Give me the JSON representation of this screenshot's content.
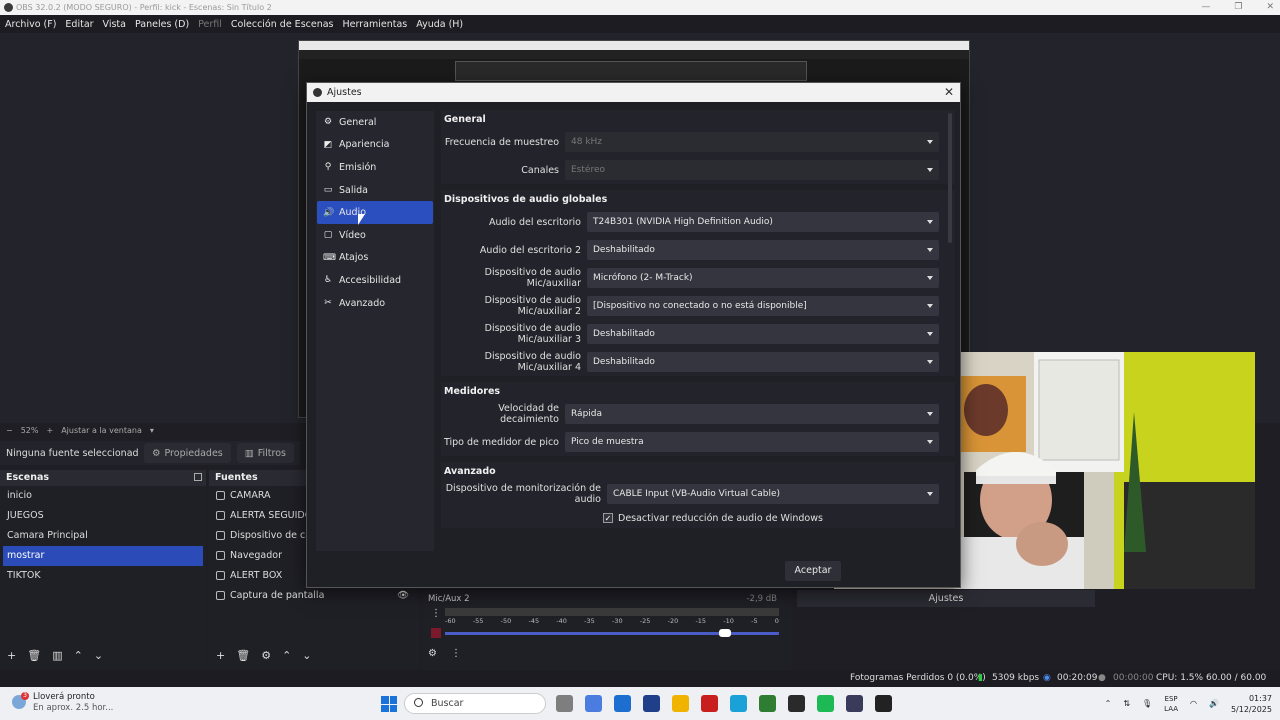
{
  "window": {
    "title": "OBS 32.0.2 (MODO SEGURO) - Perfil: kick - Escenas: Sin Título 2",
    "controls": [
      "—",
      "❐",
      "✕"
    ]
  },
  "menu": [
    "Archivo (F)",
    "Editar",
    "Vista",
    "Paneles (D)",
    "Perfil",
    "Colección de Escenas",
    "Herramientas",
    "Ayuda (H)"
  ],
  "preview": {
    "zoom": "52%",
    "fit_label": "Ajustar a la ventana"
  },
  "properties_strip": {
    "no_source": "Ninguna fuente seleccionad",
    "properties_btn": "Propiedades",
    "filters_btn": "Filtros"
  },
  "scenes": {
    "header": "Escenas",
    "items": [
      "inicio",
      "JUEGOS",
      "Camara Principal",
      "mostrar",
      "TIKTOK"
    ],
    "selected": "mostrar"
  },
  "sources": {
    "header": "Fuentes",
    "items": [
      "CAMARA",
      "ALERTA SEGUIDOR",
      "Dispositivo de capt",
      "Navegador",
      "ALERT BOX",
      "Captura de pantalla"
    ]
  },
  "mixer": {
    "label": "Mic/Aux 2",
    "db": "-2,9 dB",
    "ticks": [
      "-60",
      "-55",
      "-50",
      "-45",
      "-40",
      "-35",
      "-30",
      "-25",
      "-20",
      "-15",
      "-10",
      "-5",
      "0"
    ]
  },
  "controls_dock": {
    "settings_button": "Ajustes"
  },
  "status": {
    "dropped": "Fotogramas Perdidos 0 (0.0%)",
    "bitrate": "5309 kbps",
    "stream_time": "00:20:09",
    "rec_time": "00:00:00",
    "cpu": "CPU: 1.5%",
    "fps": "60.00 / 60.00 FPS"
  },
  "taskbar": {
    "weather_title": "Lloverá pronto",
    "weather_sub": "En aprox. 2.5 hor...",
    "weather_badge": "3",
    "search_placeholder": "Buscar",
    "lang_top": "ESP",
    "lang_bottom": "LAA",
    "time": "01:37",
    "date": "5/12/2025",
    "app_colors": [
      "#7e7e7e",
      "#4b7de0",
      "#1c6fd1",
      "#1f3f8a",
      "#f0b400",
      "#c81e1e",
      "#1aa1d8",
      "#2e7d32",
      "#2a2a2a",
      "#1db954",
      "#3a3a5a",
      "#222222"
    ]
  },
  "settings_dialog": {
    "title": "Ajustes",
    "close": "✕",
    "nav": [
      {
        "label": "General",
        "icon": "gear-icon",
        "glyph": "⚙"
      },
      {
        "label": "Apariencia",
        "icon": "appearance-icon",
        "glyph": "◩"
      },
      {
        "label": "Emisión",
        "icon": "antenna-icon",
        "glyph": "⚲"
      },
      {
        "label": "Salida",
        "icon": "output-icon",
        "glyph": "▭"
      },
      {
        "label": "Audio",
        "icon": "speaker-icon",
        "glyph": "🔊"
      },
      {
        "label": "Vídeo",
        "icon": "monitor-icon",
        "glyph": "▢"
      },
      {
        "label": "Atajos",
        "icon": "keyboard-icon",
        "glyph": "⌨"
      },
      {
        "label": "Accesibilidad",
        "icon": "accessibility-icon",
        "glyph": "♿"
      },
      {
        "label": "Avanzado",
        "icon": "tools-icon",
        "glyph": "✂"
      }
    ],
    "selected_nav": "Audio",
    "general": {
      "heading": "General",
      "sample_rate_label": "Frecuencia de muestreo",
      "sample_rate_value": "48 kHz",
      "channels_label": "Canales",
      "channels_value": "Estéreo"
    },
    "global_devices": {
      "heading": "Dispositivos de audio globales",
      "rows": [
        {
          "label": "Audio del escritorio",
          "value": "T24B301 (NVIDIA High Definition Audio)"
        },
        {
          "label": "Audio del escritorio 2",
          "value": "Deshabilitado"
        },
        {
          "label": "Dispositivo de audio Mic/auxiliar",
          "value": "Micrófono (2- M-Track)"
        },
        {
          "label": "Dispositivo de audio Mic/auxiliar 2",
          "value": "[Dispositivo no conectado o no está disponible]"
        },
        {
          "label": "Dispositivo de audio Mic/auxiliar 3",
          "value": "Deshabilitado"
        },
        {
          "label": "Dispositivo de audio Mic/auxiliar 4",
          "value": "Deshabilitado"
        }
      ]
    },
    "meters": {
      "heading": "Medidores",
      "decay_label": "Velocidad de decaimiento",
      "decay_value": "Rápida",
      "peak_label": "Tipo de medidor de pico",
      "peak_value": "Pico de muestra"
    },
    "advanced": {
      "heading": "Avanzado",
      "monitor_label": "Dispositivo de monitorización de audio",
      "monitor_value": "CABLE Input (VB-Audio Virtual Cable)",
      "ducking_label": "Desactivar reducción de audio de Windows",
      "ducking_checked": "✓"
    },
    "accept": "Aceptar"
  }
}
